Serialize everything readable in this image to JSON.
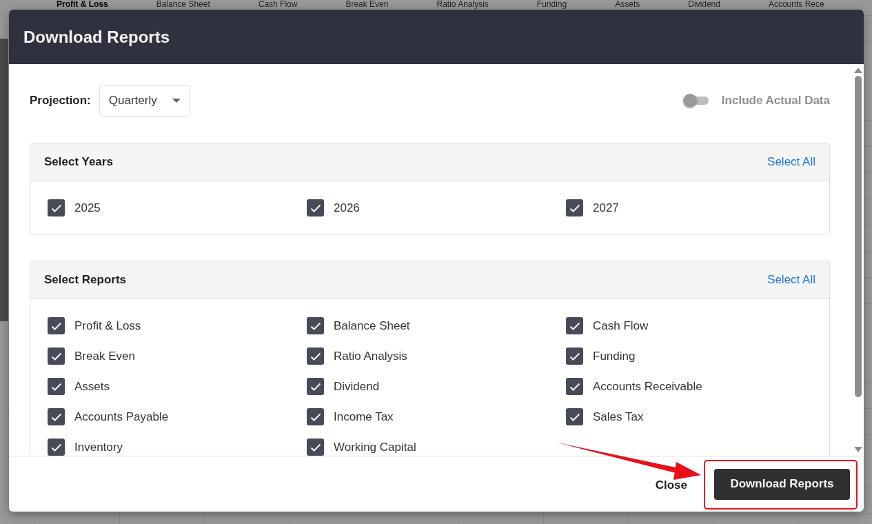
{
  "background_tabs": [
    {
      "label": "Profit & Loss",
      "selected": true
    },
    {
      "label": "Balance Sheet",
      "selected": false
    },
    {
      "label": "Cash Flow",
      "selected": false
    },
    {
      "label": "Break Even",
      "selected": false
    },
    {
      "label": "Ratio Analysis",
      "selected": false
    },
    {
      "label": "Funding",
      "selected": false
    },
    {
      "label": "Assets",
      "selected": false
    },
    {
      "label": "Dividend",
      "selected": false
    },
    {
      "label": "Accounts Rece",
      "selected": false
    }
  ],
  "dialog": {
    "title": "Download Reports",
    "projection": {
      "label": "Projection:",
      "value": "Quarterly"
    },
    "include_actual": {
      "label": "Include Actual Data",
      "on": false
    },
    "sections": [
      {
        "title": "Select Years",
        "action": "Select All",
        "items": [
          {
            "label": "2025",
            "checked": true
          },
          {
            "label": "2026",
            "checked": true
          },
          {
            "label": "2027",
            "checked": true
          }
        ]
      },
      {
        "title": "Select Reports",
        "action": "Select All",
        "items": [
          {
            "label": "Profit & Loss",
            "checked": true
          },
          {
            "label": "Balance Sheet",
            "checked": true
          },
          {
            "label": "Cash Flow",
            "checked": true
          },
          {
            "label": "Break Even",
            "checked": true
          },
          {
            "label": "Ratio Analysis",
            "checked": true
          },
          {
            "label": "Funding",
            "checked": true
          },
          {
            "label": "Assets",
            "checked": true
          },
          {
            "label": "Dividend",
            "checked": true
          },
          {
            "label": "Accounts Receivable",
            "checked": true
          },
          {
            "label": "Accounts Payable",
            "checked": true
          },
          {
            "label": "Income Tax",
            "checked": true
          },
          {
            "label": "Sales Tax",
            "checked": true
          },
          {
            "label": "Inventory",
            "checked": true
          },
          {
            "label": "Working Capital",
            "checked": true
          }
        ]
      }
    ],
    "footer": {
      "close": "Close",
      "primary": "Download Reports"
    }
  },
  "annotations": {
    "arrow": true,
    "highlight_frame": true
  }
}
